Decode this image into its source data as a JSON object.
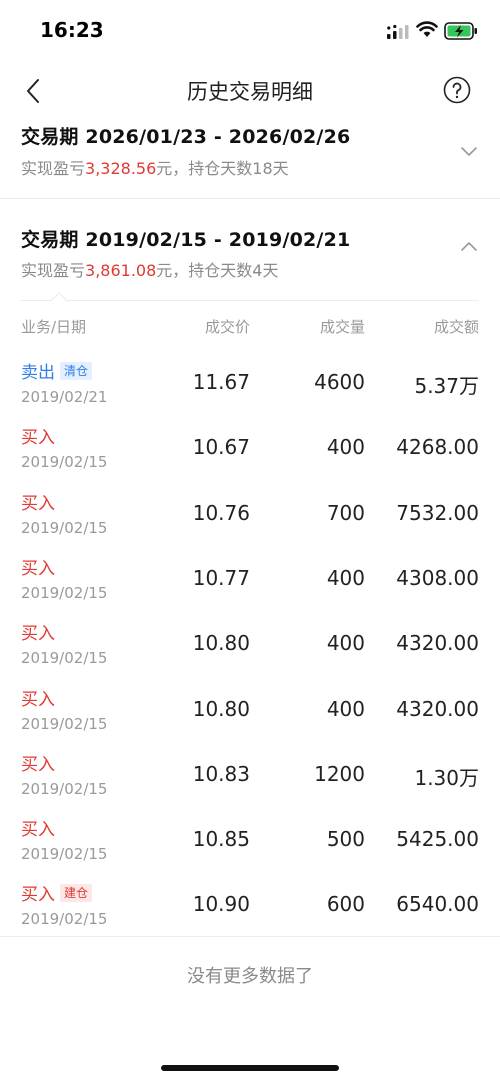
{
  "status_bar": {
    "time": "16:23"
  },
  "nav": {
    "title": "历史交易明细"
  },
  "periods": [
    {
      "title": "交易期 2026/01/23 - 2026/02/26",
      "pnl_prefix": "实现盈亏",
      "pnl_value": "3,328.56",
      "pnl_suffix": "元，持仓天数18天",
      "expanded": false
    },
    {
      "title": "交易期 2019/02/15 - 2019/02/21",
      "pnl_prefix": "实现盈亏",
      "pnl_value": "3,861.08",
      "pnl_suffix": "元，持仓天数4天",
      "expanded": true
    }
  ],
  "table": {
    "headers": [
      "业务/日期",
      "成交价",
      "成交量",
      "成交额"
    ],
    "rows": [
      {
        "action": "卖出",
        "type": "sell",
        "tag": "清仓",
        "tag_color": "blue",
        "date": "2019/02/21",
        "price": "11.67",
        "qty": "4600",
        "amount": "5.37万"
      },
      {
        "action": "买入",
        "type": "buy",
        "tag": "",
        "tag_color": "",
        "date": "2019/02/15",
        "price": "10.67",
        "qty": "400",
        "amount": "4268.00"
      },
      {
        "action": "买入",
        "type": "buy",
        "tag": "",
        "tag_color": "",
        "date": "2019/02/15",
        "price": "10.76",
        "qty": "700",
        "amount": "7532.00"
      },
      {
        "action": "买入",
        "type": "buy",
        "tag": "",
        "tag_color": "",
        "date": "2019/02/15",
        "price": "10.77",
        "qty": "400",
        "amount": "4308.00"
      },
      {
        "action": "买入",
        "type": "buy",
        "tag": "",
        "tag_color": "",
        "date": "2019/02/15",
        "price": "10.80",
        "qty": "400",
        "amount": "4320.00"
      },
      {
        "action": "买入",
        "type": "buy",
        "tag": "",
        "tag_color": "",
        "date": "2019/02/15",
        "price": "10.80",
        "qty": "400",
        "amount": "4320.00"
      },
      {
        "action": "买入",
        "type": "buy",
        "tag": "",
        "tag_color": "",
        "date": "2019/02/15",
        "price": "10.83",
        "qty": "1200",
        "amount": "1.30万"
      },
      {
        "action": "买入",
        "type": "buy",
        "tag": "",
        "tag_color": "",
        "date": "2019/02/15",
        "price": "10.85",
        "qty": "500",
        "amount": "5425.00"
      },
      {
        "action": "买入",
        "type": "buy",
        "tag": "建仓",
        "tag_color": "red",
        "date": "2019/02/15",
        "price": "10.90",
        "qty": "600",
        "amount": "6540.00"
      }
    ]
  },
  "footer": {
    "no_more": "没有更多数据了"
  },
  "colors": {
    "sell": "#2f7fe6",
    "buy": "#e03a32",
    "profit": "#e03a32"
  },
  "icons": [
    "back-icon",
    "help-icon",
    "chevron-down-icon",
    "chevron-up-icon",
    "signal-icon",
    "wifi-icon",
    "battery-charging-icon"
  ]
}
